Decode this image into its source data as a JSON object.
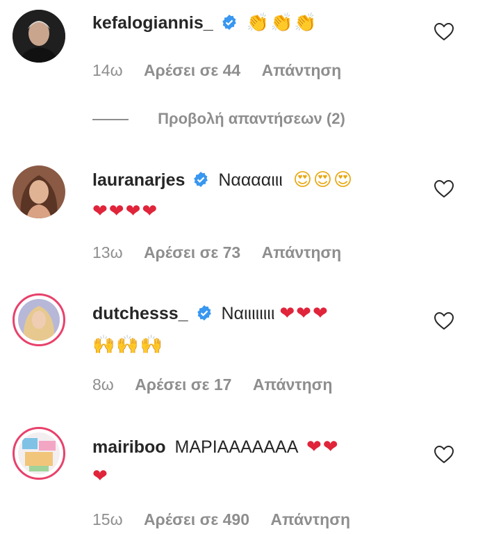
{
  "comments": [
    {
      "username": "kefalogiannis_",
      "verified": true,
      "text": "",
      "emoji_line1": "👏👏👏",
      "emoji_line2": "",
      "time": "14ω",
      "likes": "Αρέσει σε 44",
      "reply": "Απάντηση",
      "avatar": "man-avatar"
    },
    {
      "username": "lauranarjes",
      "verified": true,
      "text": "Νααααιιι",
      "emoji_line1": "😍😍😍",
      "emoji_line2": "❤❤❤❤",
      "time": "13ω",
      "likes": "Αρέσει σε 73",
      "reply": "Απάντηση",
      "avatar": "woman-avatar"
    },
    {
      "username": "dutchesss_",
      "verified": true,
      "text": "Ναιιιιιιιι",
      "emoji_line1": "❤❤❤",
      "emoji_line2": "🙌🙌🙌",
      "time": "8ω",
      "likes": "Αρέσει σε 17",
      "reply": "Απάντηση",
      "avatar": "blonde-avatar"
    },
    {
      "username": "mairiboo",
      "verified": false,
      "text": "ΜΑΡΙΑΑΑΑΑΑΑ",
      "emoji_line1": "❤❤",
      "emoji_line2": "❤",
      "time": "15ω",
      "likes": "Αρέσει σε 490",
      "reply": "Απάντηση",
      "avatar": "collage-avatar"
    }
  ],
  "view_replies": "Προβολή απαντήσεων (2)",
  "colors": {
    "verified": "#3897f0",
    "heart": "#e0243a",
    "ring": "#e8416b",
    "meta": "#8e8e8e"
  }
}
